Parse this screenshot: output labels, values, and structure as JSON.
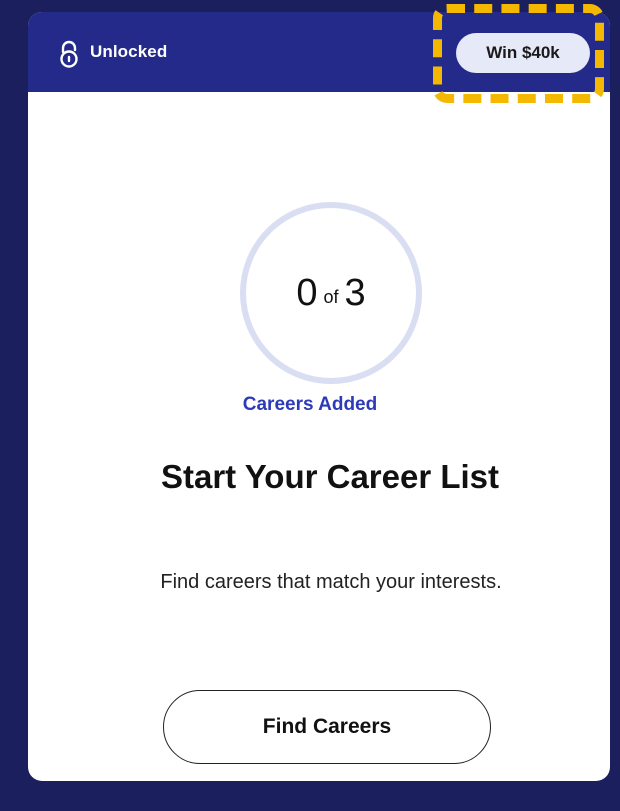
{
  "header": {
    "status_icon": "unlocked-padlock-icon",
    "status_label": "Unlocked",
    "prize_label": "Win $40k"
  },
  "progress": {
    "current": "0",
    "of_label": "of",
    "total": "3",
    "fraction": 0,
    "caption": "Careers Added"
  },
  "main": {
    "title": "Start Your Career List",
    "subtitle": "Find careers that match your interests.",
    "cta_label": "Find Careers"
  },
  "colors": {
    "page_background": "#1c1f5e",
    "header_background": "#232a8a",
    "badge_background": "#e6e9f7",
    "highlight": "#f5b800",
    "accent_text": "#2d3bb8",
    "ring": "#d9def2"
  }
}
